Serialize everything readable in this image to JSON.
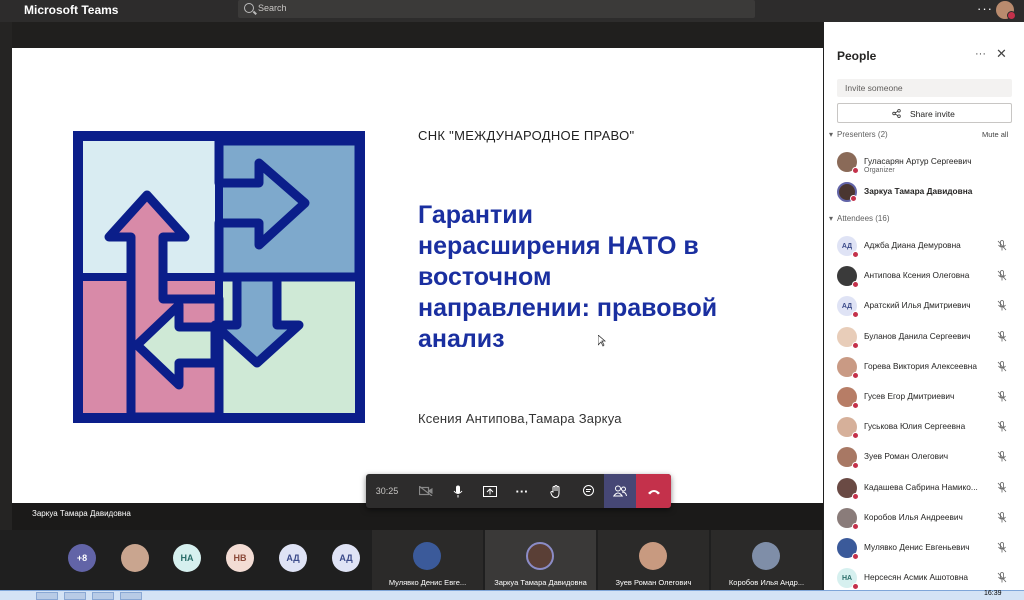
{
  "app": {
    "title": "Microsoft Teams"
  },
  "search": {
    "placeholder": "Search"
  },
  "slide": {
    "org": "СНК \"МЕЖДУНАРОДНОЕ ПРАВО\"",
    "title_lines": [
      "Гарантии",
      "нерасширения НАТО в",
      "восточном",
      "направлении: правовой",
      "анализ"
    ],
    "authors": "Ксения Антипова,Тамара Заркуа"
  },
  "presenter_name": "Заркуа Тамара Давидовна",
  "controls": {
    "timer": "30:25",
    "icons": [
      "camera-off-icon",
      "mic-icon",
      "share-screen-icon",
      "more-icon",
      "raise-hand-icon",
      "chat-icon",
      "people-icon",
      "hangup-icon"
    ]
  },
  "gallery": {
    "overflow": "+8",
    "initials": [
      "НА",
      "НВ",
      "АД",
      "АД"
    ],
    "tiles": [
      "Мулявко Денис Евге...",
      "Заркуа Тамара Давидовна",
      "Зуев Роман Олегович",
      "Коробов Илья Андр..."
    ]
  },
  "people": {
    "title": "People",
    "invite_placeholder": "Invite someone",
    "share_invite": "Share invite",
    "presenters_label": "Presenters (2)",
    "mute_all": "Mute all",
    "attendees_label": "Attendees (16)",
    "presenters": [
      {
        "name": "Гуласарян Артур Сергеевич",
        "role": "Organizer"
      },
      {
        "name": "Заркуа Тамара Давидовна",
        "role": ""
      }
    ],
    "attendees": [
      {
        "name": "Аджба Диана Демуровна",
        "initials": "АД"
      },
      {
        "name": "Антипова Ксения Олеговна",
        "initials": ""
      },
      {
        "name": "Аратский Илья Дмитриевич",
        "initials": "АД"
      },
      {
        "name": "Буланов Данила Сергеевич",
        "initials": ""
      },
      {
        "name": "Горева Виктория Алексеевна",
        "initials": ""
      },
      {
        "name": "Гусев Егор Дмитриевич",
        "initials": ""
      },
      {
        "name": "Гуськова Юлия Сергеевна",
        "initials": ""
      },
      {
        "name": "Зуев Роман Олегович",
        "initials": ""
      },
      {
        "name": "Кадашева Сабрина Намико...",
        "initials": ""
      },
      {
        "name": "Коробов Илья Андреевич",
        "initials": ""
      },
      {
        "name": "Мулявко Денис Евгеньевич",
        "initials": ""
      },
      {
        "name": "Нерсесян Асмик Ашотовна",
        "initials": "НА"
      }
    ]
  },
  "taskbar": {
    "time": "16:39"
  },
  "colors": {
    "accent": "#464775",
    "hangup": "#c4314b",
    "slide_title": "#1a2fa0",
    "puzzle_frame": "#0b1e8a"
  }
}
